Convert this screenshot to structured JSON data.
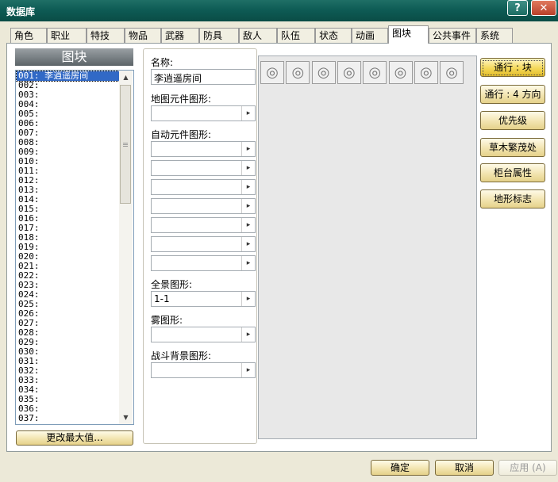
{
  "window": {
    "title": "数据库",
    "help_label": "?",
    "close_label": "✕"
  },
  "tabs": [
    "角色",
    "职业",
    "特技",
    "物品",
    "武器",
    "防具",
    "敌人",
    "队伍",
    "状态",
    "动画",
    "图块",
    "公共事件",
    "系统"
  ],
  "active_tab": "图块",
  "list": {
    "header": "图块",
    "items": [
      "001: 李逍遥房间",
      "002:",
      "003:",
      "004:",
      "005:",
      "006:",
      "007:",
      "008:",
      "009:",
      "010:",
      "011:",
      "012:",
      "013:",
      "014:",
      "015:",
      "016:",
      "017:",
      "018:",
      "019:",
      "020:",
      "021:",
      "022:",
      "023:",
      "024:",
      "025:",
      "026:",
      "027:",
      "028:",
      "029:",
      "030:",
      "031:",
      "032:",
      "033:",
      "034:",
      "035:",
      "036:",
      "037:"
    ],
    "selected_index": 0,
    "change_max_label": "更改最大值..."
  },
  "form": {
    "name_label": "名称:",
    "name_value": "李逍遥房间",
    "tileset_label": "地图元件图形:",
    "tileset_value": "",
    "autotile_label": "自动元件图形:",
    "autotiles": [
      "",
      "",
      "",
      "",
      "",
      "",
      ""
    ],
    "panorama_label": "全景图形:",
    "panorama_value": "1-1",
    "fog_label": "雾图形:",
    "fog_value": "",
    "battleback_label": "战斗背景图形:",
    "battleback_value": ""
  },
  "tiles": [
    "◎",
    "◎",
    "◎",
    "◎",
    "◎",
    "◎",
    "◎",
    "◎"
  ],
  "right_buttons": [
    "通行 : 块",
    "通行 : 4 方向",
    "优先级",
    "草木繁茂处",
    "柜台属性",
    "地形标志"
  ],
  "bottom_buttons": {
    "ok": "确定",
    "cancel": "取消",
    "apply": "应用 (A)"
  },
  "arrow_glyph": "▸",
  "icons": {
    "scroll_up": "▲",
    "scroll_down": "▼"
  }
}
